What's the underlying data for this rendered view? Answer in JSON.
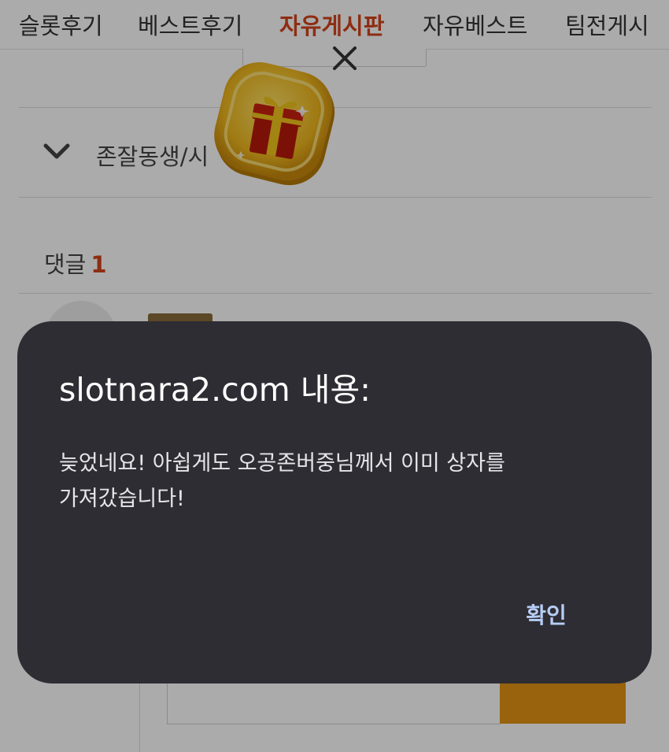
{
  "nav": {
    "items": [
      {
        "label": "슬롯후기"
      },
      {
        "label": "베스트후기"
      },
      {
        "label": "자유게시판",
        "active": true
      },
      {
        "label": "자유베스트"
      },
      {
        "label": "팀전게시"
      }
    ]
  },
  "post": {
    "category_label": "존잘동생/시"
  },
  "comments": {
    "heading": "댓글",
    "count": "1"
  },
  "dialog": {
    "title": "slotnara2.com 내용:",
    "message_line1": "늦었네요! 아쉽게도 오공존버중님께서 이미 상자를",
    "message_line2": "가져갔습니다!",
    "ok_label": "확인"
  },
  "icons": {
    "close": "close-icon",
    "chevron": "chevron-down-icon",
    "gift": "gift-coin-icon"
  },
  "colors": {
    "accent": "#d4441c",
    "dialog_bg": "#2e2d33",
    "dialog_button_text": "#b6cdf5",
    "submit_button": "#e39412"
  }
}
